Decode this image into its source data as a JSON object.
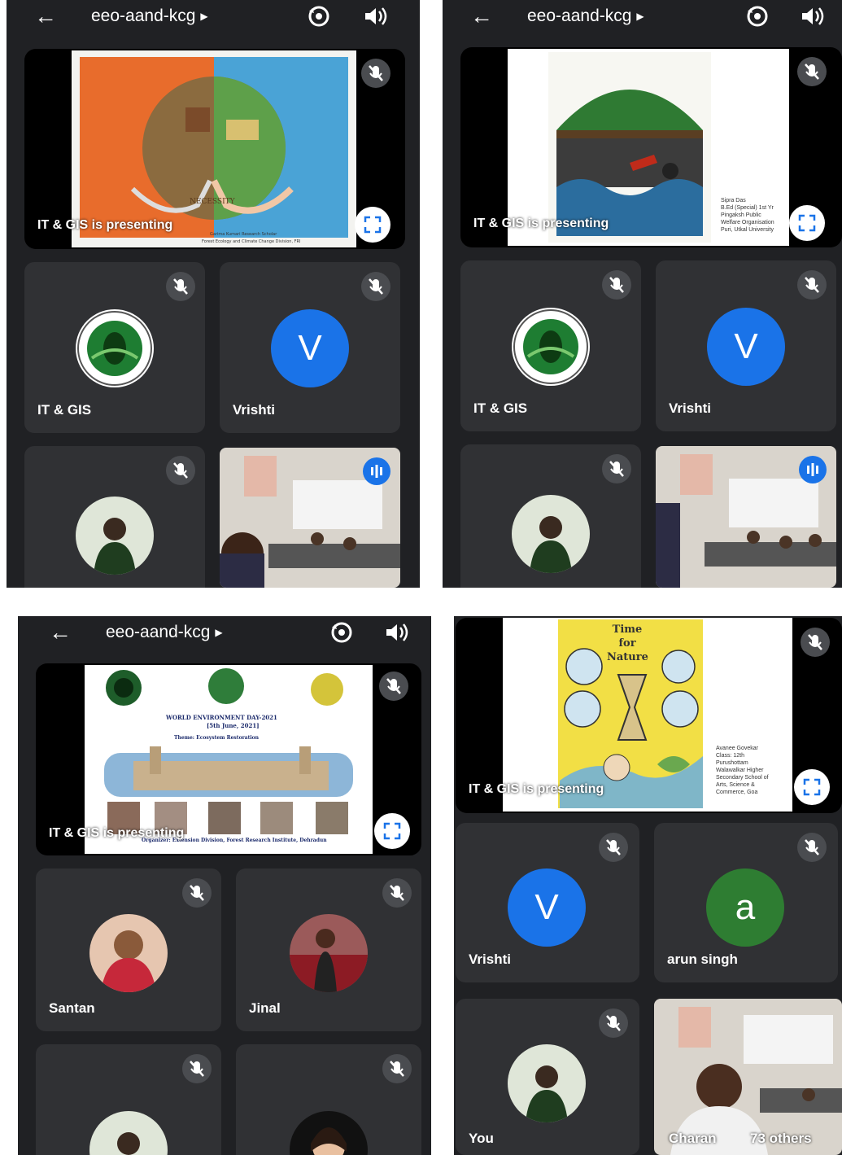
{
  "meeting": {
    "title": "eeo-aand-kcg",
    "back_icon": "arrow-back-icon",
    "camera_icon": "switch-camera-icon",
    "speaker_icon": "speaker-icon"
  },
  "presenting_label": "IT & GIS is presenting",
  "colors": {
    "background": "#202124",
    "tile": "#303134",
    "blue_avatar": "#1a73e8",
    "green_avatar": "#2e7d32"
  },
  "panel1": {
    "tiles": [
      {
        "name": "IT & GIS"
      },
      {
        "name": "Vrishti",
        "letter": "V"
      }
    ],
    "slide_text": {
      "necessity": "NECESSITY",
      "credit": "Garima Kumari Research Scholar",
      "credit2": "Forest Ecology and Climate Change Division, FRI"
    }
  },
  "panel2": {
    "tiles": [
      {
        "name": "IT & GIS"
      },
      {
        "name": "Vrishti",
        "letter": "V"
      }
    ],
    "slide_caption": [
      "Sipra Das",
      "B.Ed (Special) 1st Yr",
      "Pingaksh Public",
      "Welfare Organisation",
      "Puri, Utkal University"
    ]
  },
  "panel3": {
    "slide": {
      "event": "WORLD ENVIRONMENT DAY-2021",
      "date": "[5th June, 2021]",
      "theme": "Theme: Ecosystem Restoration",
      "organizer": "Organizer: Extension Division, Forest Research Institute, Dehradun"
    },
    "tiles": [
      {
        "name": "Santan"
      },
      {
        "name": "Jinal"
      }
    ]
  },
  "panel4": {
    "slide": {
      "heading": "Time for Nature",
      "caption": [
        "Avanee Govekar",
        "Class: 12th",
        "Purushottam",
        "Walawalkar Higher",
        "Secondary School of",
        "Arts, Science &",
        "Commerce, Goa"
      ]
    },
    "tiles": [
      {
        "name": "Vrishti",
        "letter": "V"
      },
      {
        "name": "arun singh",
        "letter": "a"
      },
      {
        "name": "You"
      },
      {
        "name": "Charan"
      }
    ],
    "others": "73 others"
  }
}
